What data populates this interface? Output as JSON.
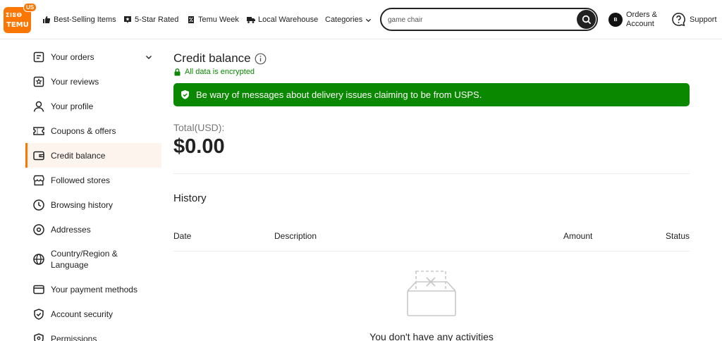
{
  "header": {
    "logo": {
      "line1": "ⵉⵏⵓⴱ",
      "line2": "TEMU",
      "badge": "US"
    },
    "nav": [
      {
        "label": "Best-Selling Items",
        "icon": "thumbs-up-icon"
      },
      {
        "label": "5-Star Rated",
        "icon": "star-chat-icon"
      },
      {
        "label": "Temu Week",
        "icon": "percent-tag-icon"
      },
      {
        "label": "Local Warehouse",
        "icon": "truck-icon"
      },
      {
        "label": "Categories",
        "icon": "chevron-down-icon"
      }
    ],
    "search": {
      "value": "game chair",
      "placeholder": ""
    },
    "orders_account": "Orders & Account",
    "avatar_letter": "B",
    "support": "Support"
  },
  "sidebar": {
    "items": [
      {
        "label": "Your orders",
        "icon": "orders-icon"
      },
      {
        "label": "Your reviews",
        "icon": "reviews-icon"
      },
      {
        "label": "Your profile",
        "icon": "profile-icon"
      },
      {
        "label": "Coupons & offers",
        "icon": "coupon-icon"
      },
      {
        "label": "Credit balance",
        "icon": "wallet-icon"
      },
      {
        "label": "Followed stores",
        "icon": "store-icon"
      },
      {
        "label": "Browsing history",
        "icon": "clock-icon"
      },
      {
        "label": "Addresses",
        "icon": "location-icon"
      },
      {
        "label": "Country/Region & Language",
        "icon": "globe-icon"
      },
      {
        "label": "Your payment methods",
        "icon": "card-icon"
      },
      {
        "label": "Account security",
        "icon": "shield-icon"
      },
      {
        "label": "Permissions",
        "icon": "permissions-icon"
      }
    ]
  },
  "main": {
    "title": "Credit balance",
    "encrypted": "All data is encrypted",
    "banner": "Be wary of messages about delivery issues claiming to be from USPS.",
    "total_label": "Total(USD):",
    "total_value": "$0.00",
    "history_title": "History",
    "columns": {
      "date": "Date",
      "description": "Description",
      "amount": "Amount",
      "status": "Status"
    },
    "empty_text": "You don't have any activities"
  },
  "colors": {
    "accent": "#fb7701",
    "success": "#0a8800",
    "text": "#222222",
    "active_bg": "#fdf4ee"
  }
}
